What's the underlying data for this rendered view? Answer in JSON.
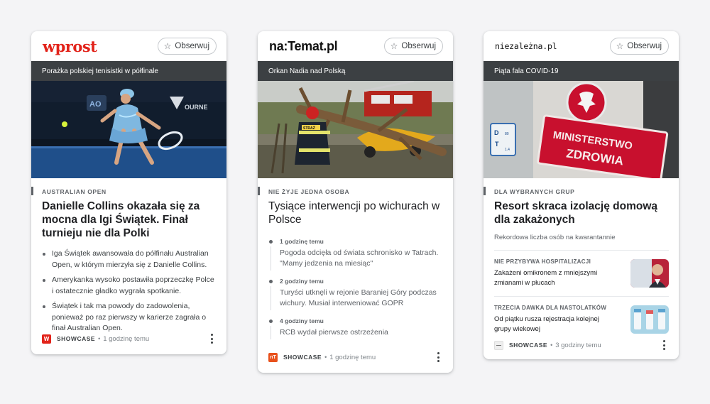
{
  "follow_label": "Obserwuj",
  "cards": [
    {
      "publisher": "wprost",
      "topic": "Porażka polskiej tenisistki w półfinale",
      "kicker": "AUSTRALIAN OPEN",
      "headline": "Danielle Collins okazała się za mocna dla Igi Świątek. Finał turnieju nie dla Polki",
      "bullets": [
        "Iga Świątek awansowała do półfinału Australian Open, w którym mierzyła się z Danielle Collins.",
        "Amerykanka wysoko postawiła poprzeczkę Polce i ostatecznie gładko wygrała spotkanie.",
        "Świątek i tak ma powody do zadowolenia, ponieważ po raz pierwszy w karierze zagrała o finał Australian Open."
      ],
      "footer": {
        "source": "SHOWCASE",
        "time": "1 godzinę temu"
      },
      "colors": {
        "brand": "#e2231a"
      },
      "hero_icon": "tennis-player-photo"
    },
    {
      "publisher": "na:Temat.pl",
      "topic": "Orkan Nadia nad Polską",
      "kicker": "NIE ŻYJE JEDNA OSOBA",
      "headline": "Tysiące interwencji po wichurach w Polsce",
      "timeline": [
        {
          "time": "1 godzinę temu",
          "text": "Pogoda odcięła od świata schronisko w Tatrach. \"Mamy jedzenia na miesiąc\""
        },
        {
          "time": "2 godziny temu",
          "text": "Turyści utknęli w rejonie Baraniej Góry podczas wichury. Musiał interweniować GOPR"
        },
        {
          "time": "4 godziny temu",
          "text": "RCB wydał pierwsze ostrzeżenia"
        }
      ],
      "footer": {
        "source": "SHOWCASE",
        "time": "1 godzinę temu"
      },
      "colors": {
        "brand": "#e8511c"
      },
      "hero_icon": "firefighter-fallen-tree-photo"
    },
    {
      "publisher": "niezależna.pl",
      "topic": "Piąta fala COVID-19",
      "kicker": "DLA WYBRANYCH GRUP",
      "headline": "Resort skraca izolację domową dla zakażonych",
      "subtitle": "Rekordowa liczba osób na kwarantannie",
      "sign_text": [
        "MINISTERSTWO",
        "ZDROWIA"
      ],
      "plate_text": [
        "D",
        "80",
        "T",
        "1.4"
      ],
      "related": [
        {
          "kicker": "NIE PRZYBYWA HOSPITALIZACJI",
          "title": "Zakażeni omikronem z mniejszymi zmianami w płucach",
          "thumb": "doctor-photo"
        },
        {
          "kicker": "TRZECIA DAWKA DLA NASTOLATKÓW",
          "title": "Od piątku rusza rejestracja kolejnej grupy wiekowej",
          "thumb": "vaccine-vials-photo"
        }
      ],
      "footer": {
        "source": "SHOWCASE",
        "time": "3 godziny temu"
      },
      "colors": {
        "brand": "#c8102e"
      },
      "hero_icon": "ministry-of-health-sign-photo"
    }
  ]
}
